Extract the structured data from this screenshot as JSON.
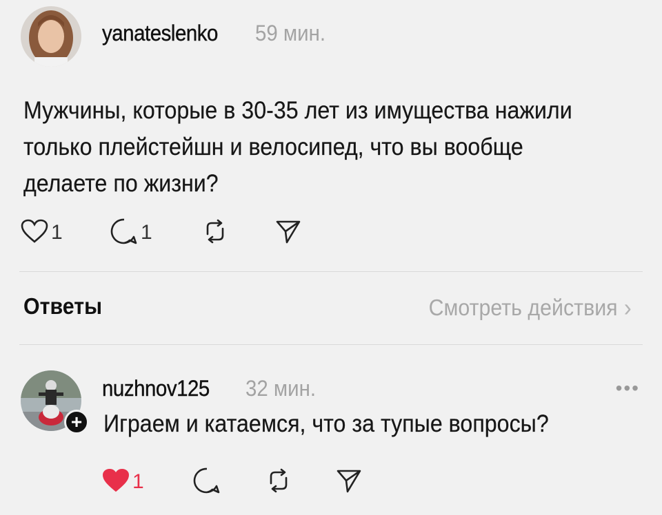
{
  "post": {
    "username": "yanateslenko",
    "time": "59 мин.",
    "text": "Мужчины, которые в 30-35 лет из имущества нажили только плейстейшн и велосипед, что вы вообще делаете по жизни?",
    "likes": "1",
    "comments": "1"
  },
  "replies_section": {
    "title": "Ответы",
    "view_activity": "Смотреть действия",
    "chevron": "›"
  },
  "reply": {
    "username": "nuzhnov125",
    "time": "32 мин.",
    "text": "Играем и катаемся, что за тупые вопросы?",
    "likes": "1",
    "more": "•••",
    "follow_badge": "+"
  },
  "colors": {
    "background": "#f1f1f1",
    "text": "#171717",
    "muted": "#a3a3a3",
    "liked_heart": "#e8304a"
  },
  "icons": [
    "heart-icon",
    "comment-icon",
    "repost-icon",
    "share-icon",
    "chevron-right-icon",
    "more-icon",
    "plus-icon"
  ]
}
